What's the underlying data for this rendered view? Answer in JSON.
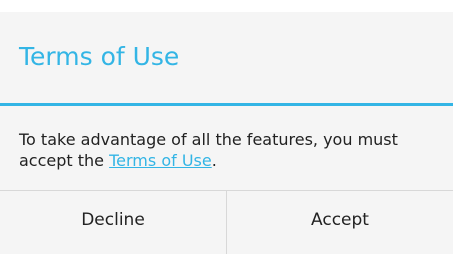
{
  "dialog": {
    "title": "Terms of Use",
    "message_prefix": "To take advantage of all the features, you must accept the ",
    "message_link": "Terms of Use",
    "message_suffix": ".",
    "buttons": {
      "decline": "Decline",
      "accept": "Accept"
    }
  },
  "colors": {
    "accent": "#33b5e5",
    "background": "#f5f5f5",
    "text": "#222222",
    "divider": "#d8d8d8"
  }
}
